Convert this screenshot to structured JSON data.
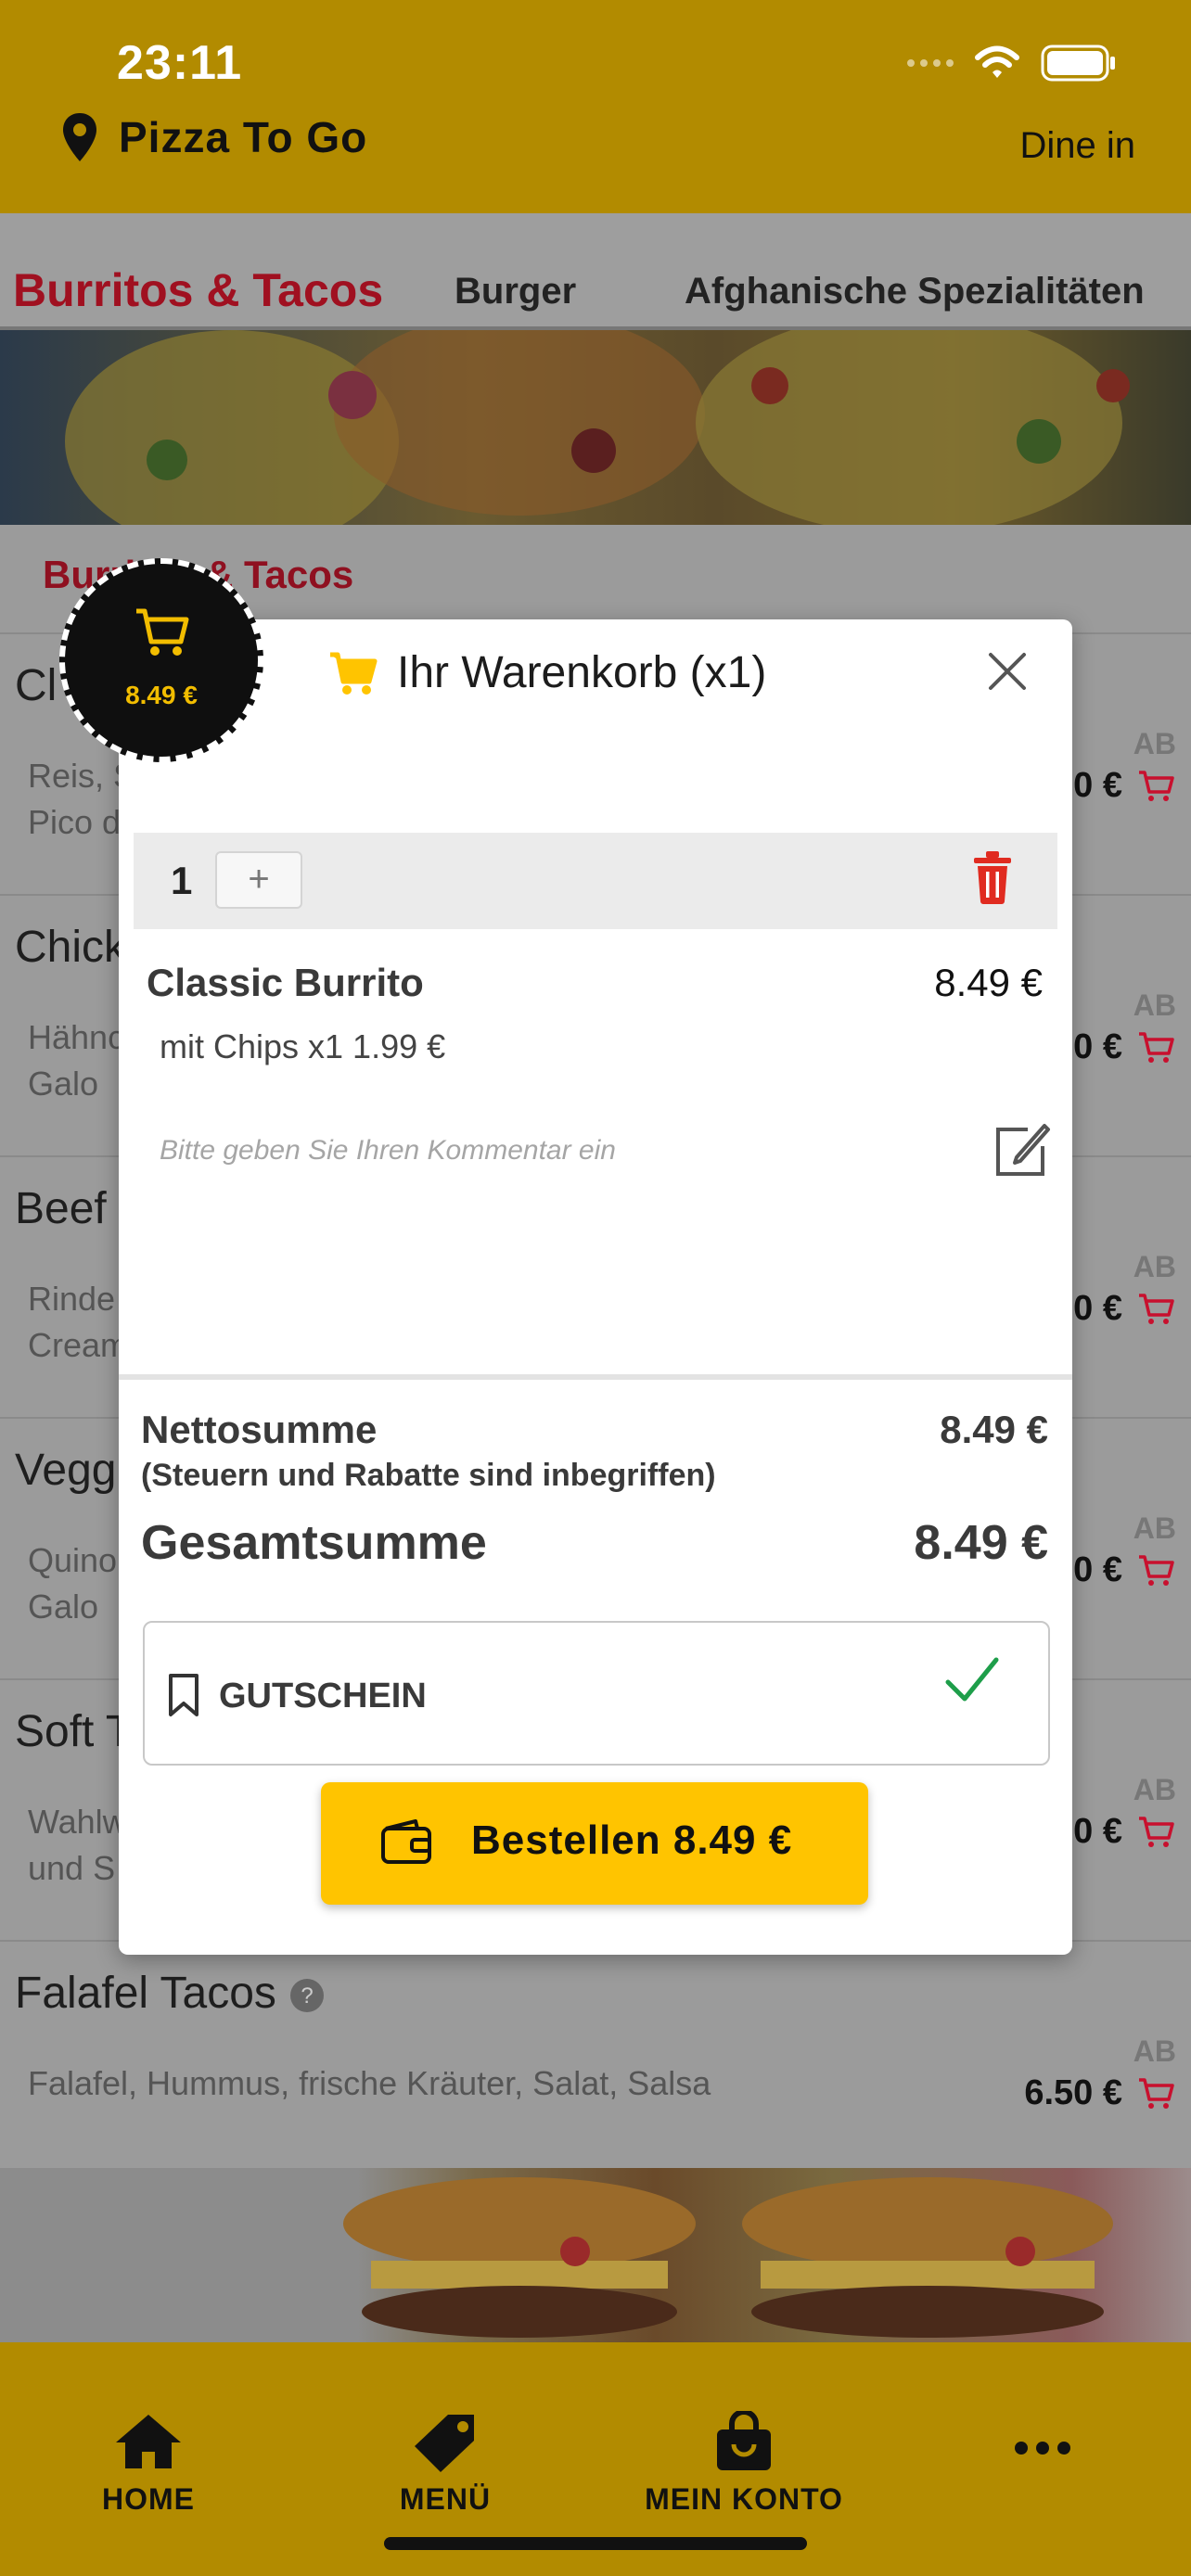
{
  "status_bar": {
    "time": "23:11"
  },
  "header": {
    "store_name": "Pizza To Go",
    "mode": "Dine in"
  },
  "category_tabs": [
    {
      "label": "Burritos & Tacos",
      "active": true
    },
    {
      "label": "Burger",
      "active": false
    },
    {
      "label": "Afghanische Spezialitäten",
      "active": false
    }
  ],
  "section_title": "Burritos & Tacos",
  "menu_items": [
    {
      "name": "Cl",
      "desc1": "Reis, S",
      "desc2": "Pico d",
      "ab": "AB",
      "price": "0 €"
    },
    {
      "name": "Chick",
      "desc1": "Hähnc",
      "desc2": "Galo",
      "ab": "AB",
      "price": "0 €"
    },
    {
      "name": "Beef",
      "desc1": "Rinde",
      "desc2": "Cream",
      "ab": "AB",
      "price": "0 €"
    },
    {
      "name": "Vegg",
      "desc1": "Quino",
      "desc2": "Galo",
      "ab": "AB",
      "price": "0 €"
    },
    {
      "name": "Soft T",
      "desc1": "Wahlw",
      "desc2": "und S",
      "ab": "AB",
      "price": "0 €"
    },
    {
      "name": "Falafel Tacos",
      "desc1": "Falafel, Hummus, frische Kräuter, Salat, Salsa",
      "desc2": "",
      "ab": "AB",
      "price": "6.50 €"
    }
  ],
  "cart_badge": {
    "total": "8.49 €"
  },
  "cart_modal": {
    "title": "Ihr Warenkorb (x1)",
    "quantity": "1",
    "plus": "+",
    "item": {
      "name": "Classic Burrito",
      "price": "8.49 €",
      "extra": "mit Chips x1 1.99 €"
    },
    "comment_placeholder": "Bitte geben Sie Ihren Kommentar ein",
    "net_label": "Nettosumme",
    "net_value": "8.49 €",
    "tax_note": "(Steuern und Rabatte sind inbegriffen)",
    "total_label": "Gesamtsumme",
    "total_value": "8.49 €",
    "voucher_label": "GUTSCHEIN",
    "order_button": "Bestellen 8.49 €"
  },
  "tab_bar": [
    {
      "label": "HOME",
      "icon": "home-icon"
    },
    {
      "label": "MENÜ",
      "icon": "tag-icon"
    },
    {
      "label": "MEIN KONTO",
      "icon": "bag-icon"
    },
    {
      "label": "",
      "icon": "more-icon"
    }
  ],
  "colors": {
    "header": "#b28b00",
    "accent": "#ffc400",
    "category_active": "#a01020",
    "danger": "#e02b20",
    "check": "#1e9e4a"
  }
}
